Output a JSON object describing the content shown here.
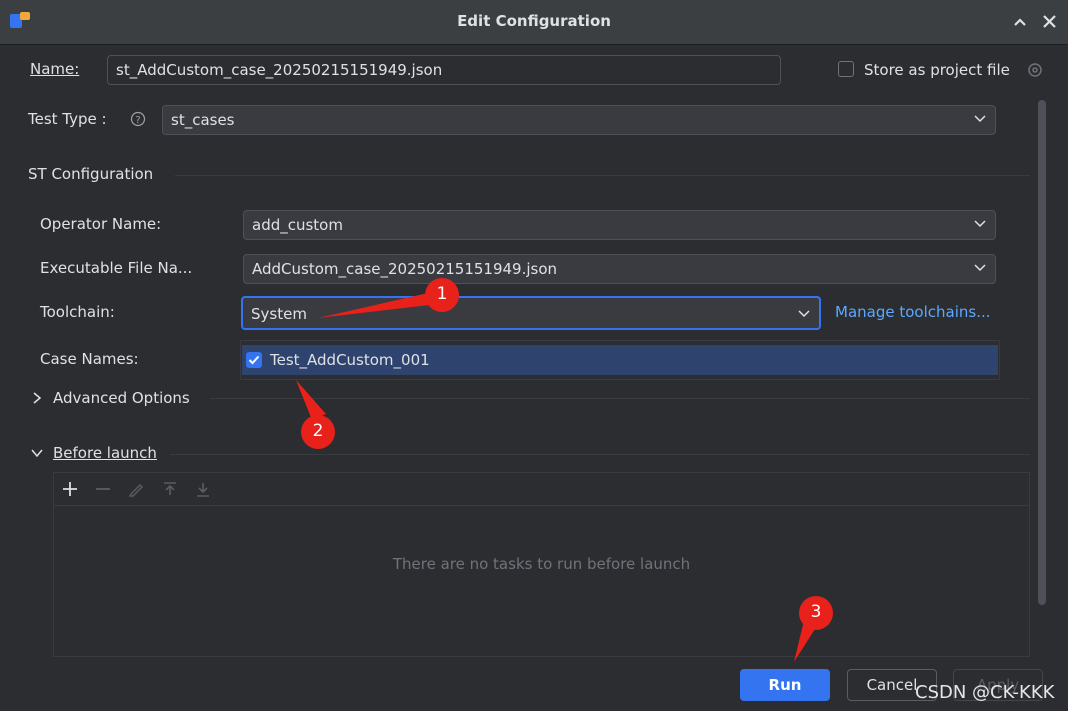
{
  "dialog": {
    "title": "Edit Configuration",
    "name_label": "Name:",
    "name_value": "st_AddCustom_case_20250215151949.json",
    "store_label": "Store as project file",
    "test_type_label": "Test Type :",
    "test_type_value": "st_cases",
    "st_section": "ST Configuration",
    "operator_label": "Operator Name:",
    "operator_value": "add_custom",
    "exec_label": "Executable File Na...",
    "exec_value": "AddCustom_case_20250215151949.json",
    "toolchain_label": "Toolchain:",
    "toolchain_value": "System",
    "manage_link": "Manage toolchains...",
    "case_label": "Case Names:",
    "case_item": "Test_AddCustom_001",
    "advanced": "Advanced Options",
    "before_launch": "Before launch",
    "empty_tasks": "There are no tasks to run before launch",
    "run": "Run",
    "cancel": "Cancel",
    "apply": "Apply"
  },
  "annotations": {
    "a1": "1",
    "a2": "2",
    "a3": "3"
  },
  "watermark": "CSDN @CK-KKK",
  "colors": {
    "accent": "#3574f0",
    "link": "#5ca8ff",
    "arrow": "#e8211b"
  }
}
